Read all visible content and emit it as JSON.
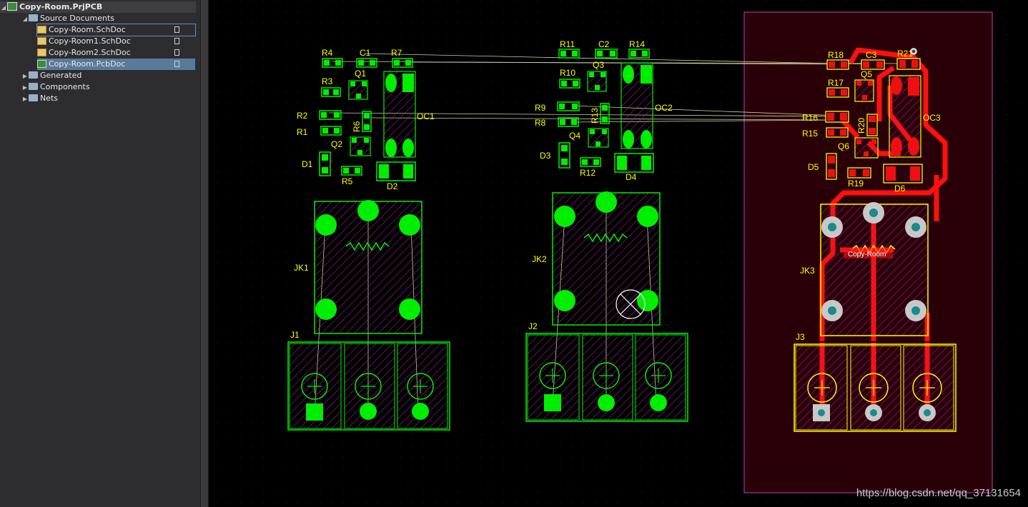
{
  "project_tree": {
    "project": "Copy-Room.PrjPCB",
    "source_documents_label": "Source Documents",
    "documents": [
      "Copy-Room.SchDoc",
      "Copy-Room1.SchDoc",
      "Copy-Room2.SchDoc",
      "Copy-Room.PcbDoc"
    ],
    "selected_document": "Copy-Room.PcbDoc",
    "folders": [
      "Generated",
      "Components",
      "Nets"
    ]
  },
  "pcb": {
    "board_label": "Copy-Room",
    "designators": {
      "r4": "R4",
      "c1": "C1",
      "r7": "R7",
      "r3": "R3",
      "q1": "Q1",
      "r2": "R2",
      "r1": "R1",
      "r6": "R6",
      "oc1": "OC1",
      "q2": "Q2",
      "d1": "D1",
      "r5": "R5",
      "d2": "D2",
      "r11": "R11",
      "c2": "C2",
      "r14": "R14",
      "r10": "R10",
      "q3": "Q3",
      "r9": "R9",
      "r13": "R13",
      "oc2": "OC2",
      "r8": "R8",
      "q4": "Q4",
      "d3": "D3",
      "r12": "R12",
      "d4": "D4",
      "r18": "R18",
      "c3": "C3",
      "r21": "R21",
      "q5": "Q5",
      "r17": "R17",
      "r16": "R16",
      "r20": "R20",
      "oc3": "OC3",
      "r15": "R15",
      "q6": "Q6",
      "d5": "D5",
      "r19": "R19",
      "d6": "D6",
      "jk1": "JK1",
      "jk2": "JK2",
      "jk3": "JK3",
      "j1": "J1",
      "j2": "J2",
      "j3": "J3"
    }
  },
  "watermark": "https://blog.csdn.net/qq_37131654",
  "colors": {
    "silk": "#ffff00",
    "pad": "#00ee00",
    "room": "#8800ff",
    "track": "#ff0000",
    "background": "#000000"
  }
}
